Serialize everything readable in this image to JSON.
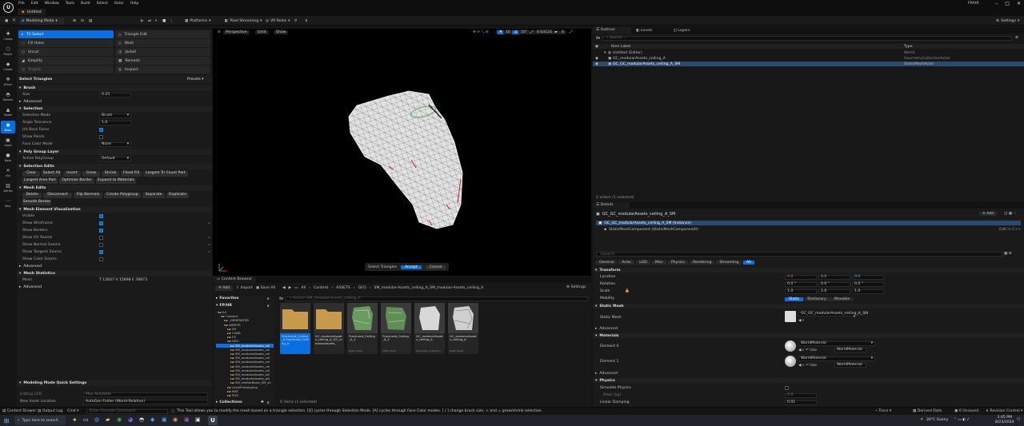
{
  "window": {
    "title": "Untitled",
    "app_name": "FP/HR",
    "menus": [
      "File",
      "Edit",
      "Window",
      "Tools",
      "Build",
      "Select",
      "Actor",
      "Help"
    ]
  },
  "toolbar": {
    "mode": "Modeling Mode",
    "platforms": "Platforms",
    "pixel_streaming": "Pixel Streaming",
    "vr_roles": "VR Roles",
    "settings": "Settings"
  },
  "modes_strip": [
    {
      "label": "Create",
      "icon": "plus-icon"
    },
    {
      "label": "PolyGr",
      "icon": "polygroup-icon"
    },
    {
      "label": "Create",
      "icon": "shape-icon"
    },
    {
      "label": "XForm",
      "icon": "transform-icon"
    },
    {
      "label": "Deform",
      "icon": "deform-icon"
    },
    {
      "label": "Model",
      "icon": "model-icon"
    },
    {
      "label": "Mesh",
      "icon": "mesh-icon",
      "active": true
    },
    {
      "label": "Voxel",
      "icon": "voxel-icon"
    },
    {
      "label": "Bake",
      "icon": "bake-icon"
    },
    {
      "label": "UVs",
      "icon": "uv-icon"
    },
    {
      "label": "Attribs",
      "icon": "attrib-icon"
    },
    {
      "label": "Misc",
      "icon": "misc-icon"
    }
  ],
  "tools": {
    "tri_select": "Tri Select",
    "triangle_edit": "Triangle Edit",
    "fill_holes": "Fill Holes",
    "weld": "Weld",
    "uncut": "Uncut",
    "jacket": "Jacket",
    "simplify": "Simplify",
    "remesh": "Remesh",
    "project": "Project",
    "inspect": "Inspect"
  },
  "panel": {
    "title": "Select Triangles",
    "presets": "Presets",
    "brush": {
      "header": "Brush",
      "size_label": "Size",
      "size_value": "0.25",
      "advanced": "Advanced"
    },
    "selection": {
      "header": "Selection",
      "mode_label": "Selection Mode",
      "mode_value": "Brush",
      "angle_label": "Angle Tolerance",
      "angle_value": "1.0",
      "hit_back_label": "Hit Back Faces",
      "show_points_label": "Show Points",
      "face_color_label": "Face Color Mode",
      "face_color_value": "None"
    },
    "polygroup": {
      "header": "Poly Group Layer",
      "active_label": "Active PolyGroup",
      "active_value": "Default"
    },
    "edits": {
      "header": "Selection Edits",
      "buttons_row1": [
        "Clear",
        "Select All",
        "Invert",
        "Grow",
        "Shrink",
        "Flood Fill",
        "Largest Tri Count Part"
      ],
      "buttons_row2": [
        "Largest Area Part",
        "Optimize Border",
        "Expand to Materials"
      ]
    },
    "mesh_edits": {
      "header": "Mesh Edits",
      "buttons_row1": [
        "Delete",
        "Disconnect",
        "Flip Normals",
        "Create Polygroup",
        "Separate",
        "Duplicate"
      ],
      "buttons_row2": [
        "Smooth Border"
      ]
    },
    "visualization": {
      "header": "Mesh Element Visualization",
      "items": [
        "Visible",
        "Show Wireframe",
        "Show Borders",
        "Show UV Seams",
        "Show Normal Seams",
        "Show Tangent Seams",
        "Show Color Seams"
      ],
      "advanced": "Advanced"
    },
    "statistics": {
      "header": "Mesh Statistics",
      "mesh_label": "Mesh",
      "mesh_value": "T 12837 V 15898 E 78673",
      "advanced": "Advanced"
    },
    "quick_settings": {
      "header": "Modeling Mode Quick Settings",
      "editing_lod_label": "Editing LOD",
      "editing_lod_value": "Max Available",
      "new_asset_label": "New Asset Location",
      "new_asset_value": "AutoGen Folder (World-Relative)"
    }
  },
  "viewport": {
    "perspective": "Perspective",
    "lit": "Unlit",
    "show": "Show",
    "grid": "10",
    "angle": "10°",
    "scale": "0.03125",
    "cam_speed": "4",
    "accept_label": "Select Triangles",
    "accept": "Accept",
    "cancel": "Cancel"
  },
  "content_browser": {
    "tab": "Content Browser",
    "add": "Add",
    "import": "Import",
    "save_all": "Save All",
    "breadcrumb": [
      "All",
      "Content",
      "ASSETS",
      "GEO",
      "SM_modular-Assets_ceiling_A_SM_modular-Assets_ceiling_A"
    ],
    "settings": "Settings",
    "favorites": "Favorites",
    "project": "FP/HR",
    "search_placeholder": "Search SM_modular-Assets_ceiling_A",
    "collections": "Collections",
    "count": "6 items (1 selected)",
    "tree": [
      "All",
      "Content",
      "_GENERATED",
      "ASSETS",
      "SH",
      "CHAR",
      "FX",
      "GEO",
      "SM_modularAssets_cei",
      "SM_modularAssets_cei",
      "SM_modularAssets_cei",
      "SM_modularAssets_cei",
      "SM_modularAssets_cei",
      "SM_modularAssets_cei",
      "SM_modularAssets_cei",
      "SM_modularAssets_pill",
      "SM_modularAssets_pill",
      "SM_shelterBasis_SM_sh",
      "LevelPrototyping",
      "MAT",
      "POS"
    ],
    "assets": [
      {
        "name": "Fractured_Ceiling_A Fractured_Ceiling_A",
        "type": "Folder",
        "selected": true
      },
      {
        "name": "GC_modularAssets_ceiling_A_GC_modularAssets_",
        "type": "Folder"
      },
      {
        "name": "Fractured_Ceiling_A_1",
        "type": "Static Mesh"
      },
      {
        "name": "Fractured_Ceiling_A_2",
        "type": "Static Mesh"
      },
      {
        "name": "GC_modularAssets_ceiling_A",
        "type": "Geometry Collection"
      },
      {
        "name": "GC_modularAssets_ceiling_A",
        "type": "Static Mesh"
      }
    ]
  },
  "outliner": {
    "tabs": [
      "Outliner",
      "Levels",
      "Layers"
    ],
    "search_placeholder": "Search...",
    "col_label": "Item Label",
    "col_type": "Type",
    "rows": [
      {
        "label": "Untitled (Editor)",
        "type": "World"
      },
      {
        "label": "GC_modularAssets_ceiling_A",
        "type": "GeometryCollectionActor"
      },
      {
        "label": "GC_GC_modularAssets_ceiling_A_SM",
        "type": "StaticMeshActor"
      }
    ],
    "footer": "2 actors (1 selected)"
  },
  "details": {
    "tab": "Details",
    "actor": "GC_GC_modularAssets_ceiling_A_SM",
    "add": "Add",
    "instance": "GC_GC_modularAssets_ceiling_A_SM (Instance)",
    "component": "StaticMeshComponent (StaticMeshComponent0)",
    "edit_in_cpp": "Edit in C++",
    "search_placeholder": "Search",
    "filters": [
      "General",
      "Actor",
      "LOD",
      "Misc",
      "Physics",
      "Rendering",
      "Streaming",
      "All"
    ],
    "transform": {
      "header": "Transform",
      "location": "Location",
      "rotation": "Rotation",
      "scale": "Scale",
      "loc_vals": [
        "0.0",
        "0.0",
        "0.0"
      ],
      "rot_vals": [
        "0.0 °",
        "0.0 °",
        "0.0 °"
      ],
      "scale_vals": [
        "1.0",
        "1.0",
        "1.0"
      ],
      "mobility": "Mobility",
      "mob_opts": [
        "Static",
        "Stationary",
        "Movable"
      ]
    },
    "static_mesh": {
      "header": "Static Mesh",
      "label": "Static Mesh",
      "value": "GC_GC_modularAssets_ceiling_A_SM",
      "advanced": "Advanced"
    },
    "materials": {
      "header": "Materials",
      "elements": [
        {
          "label": "Element 0",
          "value": "WorldMaterial"
        },
        {
          "label": "Element 1",
          "value": "WorldMaterial"
        }
      ],
      "advanced": "Advanced",
      "use": "Use"
    },
    "physics": {
      "header": "Physics",
      "simulate": "Simulate Physics",
      "mass": "Mass (kg)",
      "mass_val": "0.0",
      "linear_damping": "Linear Damping",
      "linear_val": "0.01"
    }
  },
  "status": {
    "content_drawer": "Content Drawer",
    "output_log": "Output Log",
    "cmd": "Cmd",
    "console_placeholder": "Enter Console Command",
    "hint": "This Tool allows you to modify the mesh based on a triangle selection. [Q] cycles through Selection Mode. [A] cycles through Face Color modes. [ / ] change brush size, + and = grow/shrink selection.",
    "trace": "Trace",
    "derived": "Derived Data",
    "unsaved": "6 Unsaved",
    "revision": "Revision Control"
  },
  "taskbar": {
    "search_placeholder": "Type here to search",
    "weather": "26°C  Sunny",
    "time": "3:45 PM",
    "date": "8/23/2024"
  }
}
